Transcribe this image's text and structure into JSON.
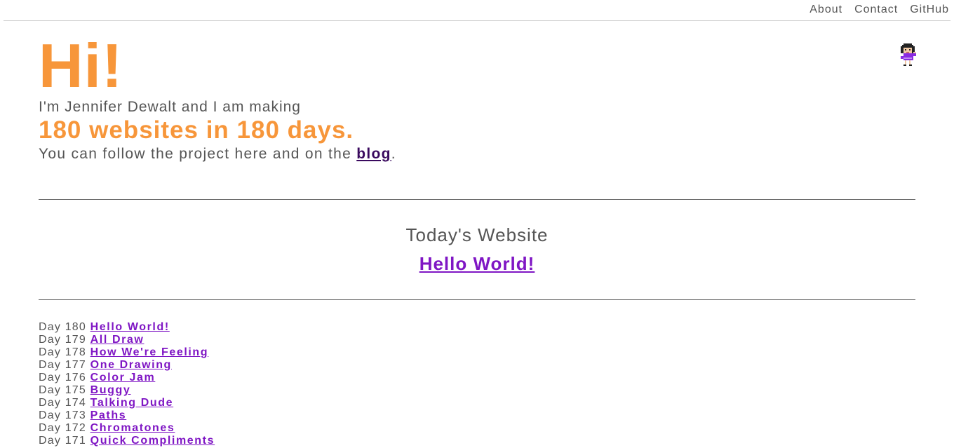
{
  "nav": {
    "about": "About",
    "contact": "Contact",
    "github": "GitHub"
  },
  "hero": {
    "greeting": "Hi!",
    "intro": "I'm Jennifer Dewalt and I am making",
    "headline": "180 websites in 180 days.",
    "follow_prefix": "You can follow the project here and on the ",
    "blog_link": "blog",
    "follow_suffix": "."
  },
  "today": {
    "heading": "Today's Website",
    "link": "Hello World!"
  },
  "days": [
    {
      "day": "Day 180",
      "title": "Hello World!"
    },
    {
      "day": "Day 179",
      "title": "All Draw"
    },
    {
      "day": "Day 178",
      "title": "How We're Feeling"
    },
    {
      "day": "Day 177",
      "title": "One Drawing"
    },
    {
      "day": "Day 176",
      "title": "Color Jam"
    },
    {
      "day": "Day 175",
      "title": "Buggy"
    },
    {
      "day": "Day 174",
      "title": "Talking Dude"
    },
    {
      "day": "Day 173",
      "title": "Paths"
    },
    {
      "day": "Day 172",
      "title": "Chromatones"
    },
    {
      "day": "Day 171",
      "title": "Quick Compliments"
    }
  ],
  "colors": {
    "accent": "#f7963a",
    "link": "#7f16c4",
    "text": "#555555"
  },
  "icons": {
    "avatar": "pixel-girl-avatar-icon"
  }
}
